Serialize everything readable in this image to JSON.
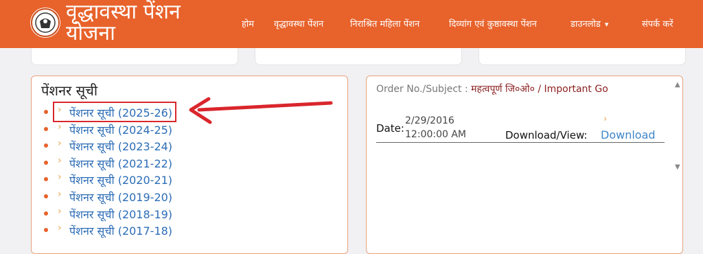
{
  "brand": {
    "line1": "वृद्धावस्था पेंशन",
    "line2": "योजना"
  },
  "nav": [
    {
      "label": "होम"
    },
    {
      "label": "वृद्धावस्था पेंशन"
    },
    {
      "label": "निराश्रित महिला पेंशन"
    },
    {
      "label": "दिव्यांग एवं कुष्ठावस्था पेंशन"
    },
    {
      "label": "डाउनलोड"
    },
    {
      "label": "संपर्क करें"
    }
  ],
  "pension_list": {
    "title": "पेंशनर सूची",
    "items": [
      {
        "label": "पेंशनर सूची",
        "year": "(2025-26)"
      },
      {
        "label": "पेंशनर सूची",
        "year": "(2024-25)"
      },
      {
        "label": "पेंशनर सूची",
        "year": "(2023-24)"
      },
      {
        "label": "पेंशनर सूची",
        "year": "(2021-22)"
      },
      {
        "label": "पेंशनर सूची",
        "year": "(2020-21)"
      },
      {
        "label": "पेंशनर सूची",
        "year": "(2019-20)"
      },
      {
        "label": "पेंशनर सूची",
        "year": "(2018-19)"
      },
      {
        "label": "पेंशनर सूची",
        "year": "(2017-18)"
      }
    ]
  },
  "notice": {
    "order_label": "Order No./Subject :",
    "order_value": "महत्वपूर्ण जि०ओ० / Important Go",
    "date_label": "Date:",
    "date_line1": "2/29/2016",
    "date_line2": "12:00:00 AM",
    "download_label": "Download/View:",
    "download_link": "Download"
  },
  "colors": {
    "header": "#e8622b",
    "link": "#2b6cb6",
    "highlight": "#d9262c"
  },
  "icons": [
    "emblem-logo",
    "chevron-down-icon",
    "bullet-dot-icon",
    "chevron-right-icon",
    "red-arrow-annotation",
    "scroll-up-icon",
    "scroll-down-icon"
  ]
}
